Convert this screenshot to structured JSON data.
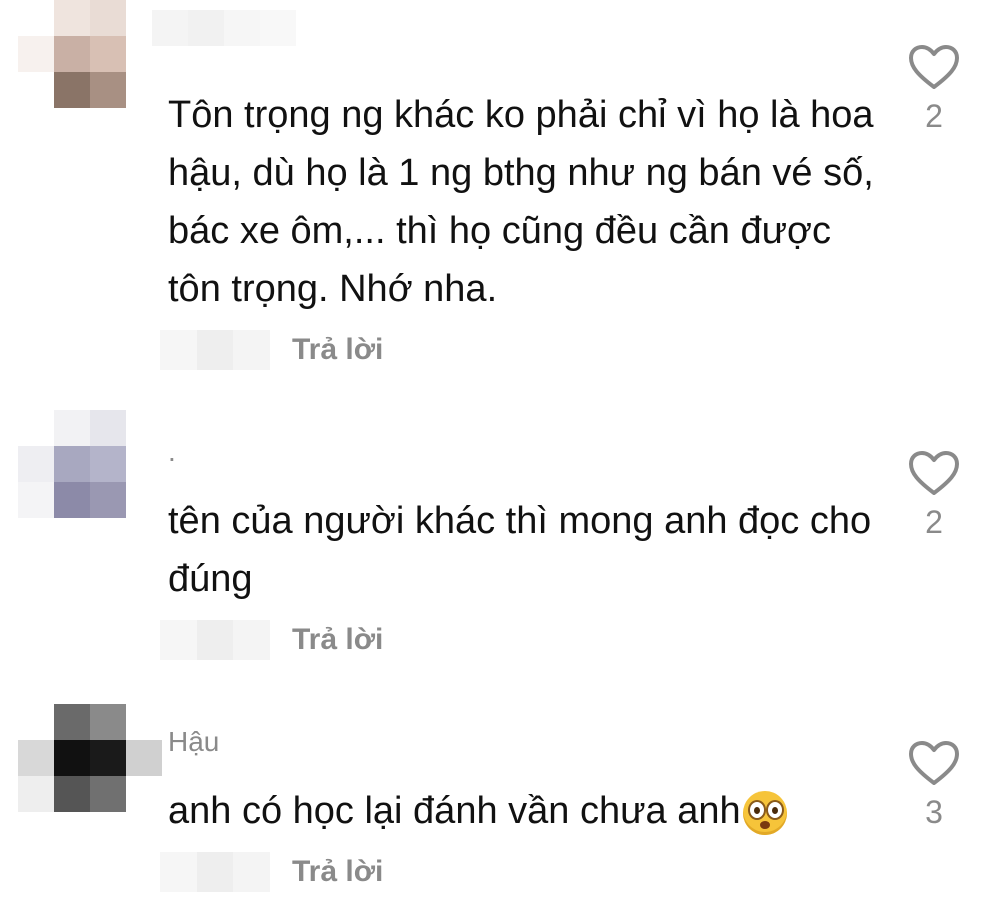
{
  "comments": [
    {
      "username": "",
      "text": "Tôn trọng ng khác ko phải chỉ vì họ là hoa hậu, dù họ là 1 ng bthg như ng bán vé số, bác xe ôm,... thì họ cũng đều cần được tôn trọng. Nhớ nha.",
      "reply_label": "Trả lời",
      "like_count": "2",
      "avatar_colors": [
        "#ffffff",
        "#efe4de",
        "#e9dcd5",
        "#ffffff",
        "#f7f1ee",
        "#c9b0a5",
        "#d8c0b4",
        "#ffffff",
        "#ffffff",
        "#8a7467",
        "#a89083",
        "#ffffff"
      ]
    },
    {
      "username": ".",
      "text": "tên của người khác thì mong anh đọc cho đúng",
      "reply_label": "Trả lời",
      "like_count": "2",
      "avatar_colors": [
        "#ffffff",
        "#f2f2f4",
        "#e6e6ec",
        "#ffffff",
        "#eeeef2",
        "#a8a8c0",
        "#b4b4ca",
        "#ffffff",
        "#f4f4f6",
        "#8c8aa8",
        "#9a98b2",
        "#ffffff"
      ]
    },
    {
      "username": "Hậu",
      "text": "anh có học lại đánh vần chưa anh",
      "reply_label": "Trả lời",
      "like_count": "3",
      "avatar_colors": [
        "#ffffff",
        "#6a6a6a",
        "#8a8a8a",
        "#ffffff",
        "#d8d8d8",
        "#111111",
        "#1a1a1a",
        "#d0d0d0",
        "#eeeeee",
        "#555555",
        "#707070",
        "#ffffff"
      ]
    }
  ],
  "colors": {
    "secondary_text": "#8a8a8a",
    "primary_text": "#111111"
  },
  "icons": {
    "like": "heart-outline-icon",
    "emoji": "flushed-face-emoji"
  }
}
